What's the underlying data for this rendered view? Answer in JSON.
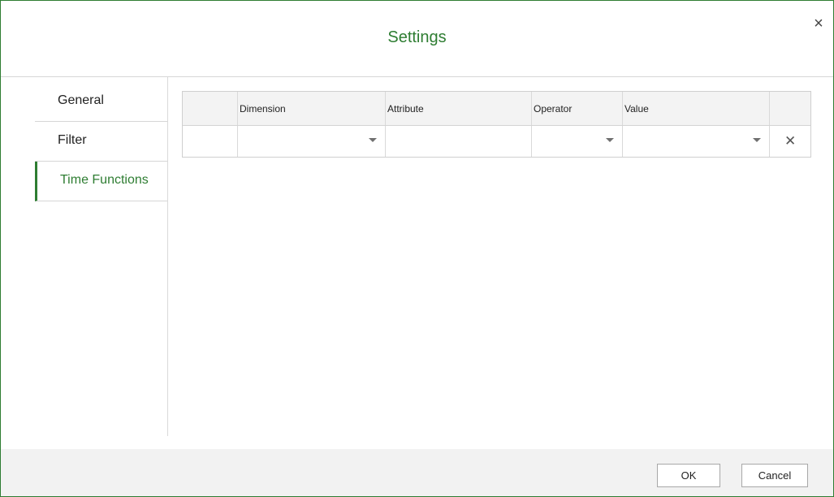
{
  "dialog": {
    "title": "Settings",
    "close_icon": "close-icon"
  },
  "sidebar": {
    "items": [
      {
        "label": "General",
        "active": false
      },
      {
        "label": "Filter",
        "active": false
      },
      {
        "label": "Time Functions",
        "active": true
      }
    ]
  },
  "grid": {
    "columns": [
      "",
      "Dimension",
      "Attribute",
      "Operator",
      "Value",
      ""
    ],
    "rows": [
      {
        "row_header": "",
        "dimension": "",
        "attribute": "",
        "operator": "",
        "value": "",
        "delete_icon": "close-icon"
      }
    ]
  },
  "footer": {
    "ok_label": "OK",
    "cancel_label": "Cancel"
  },
  "colors": {
    "accent": "#2e7d32",
    "footer_bg": "#f2f2f2",
    "grid_header_bg": "#f3f3f3"
  }
}
